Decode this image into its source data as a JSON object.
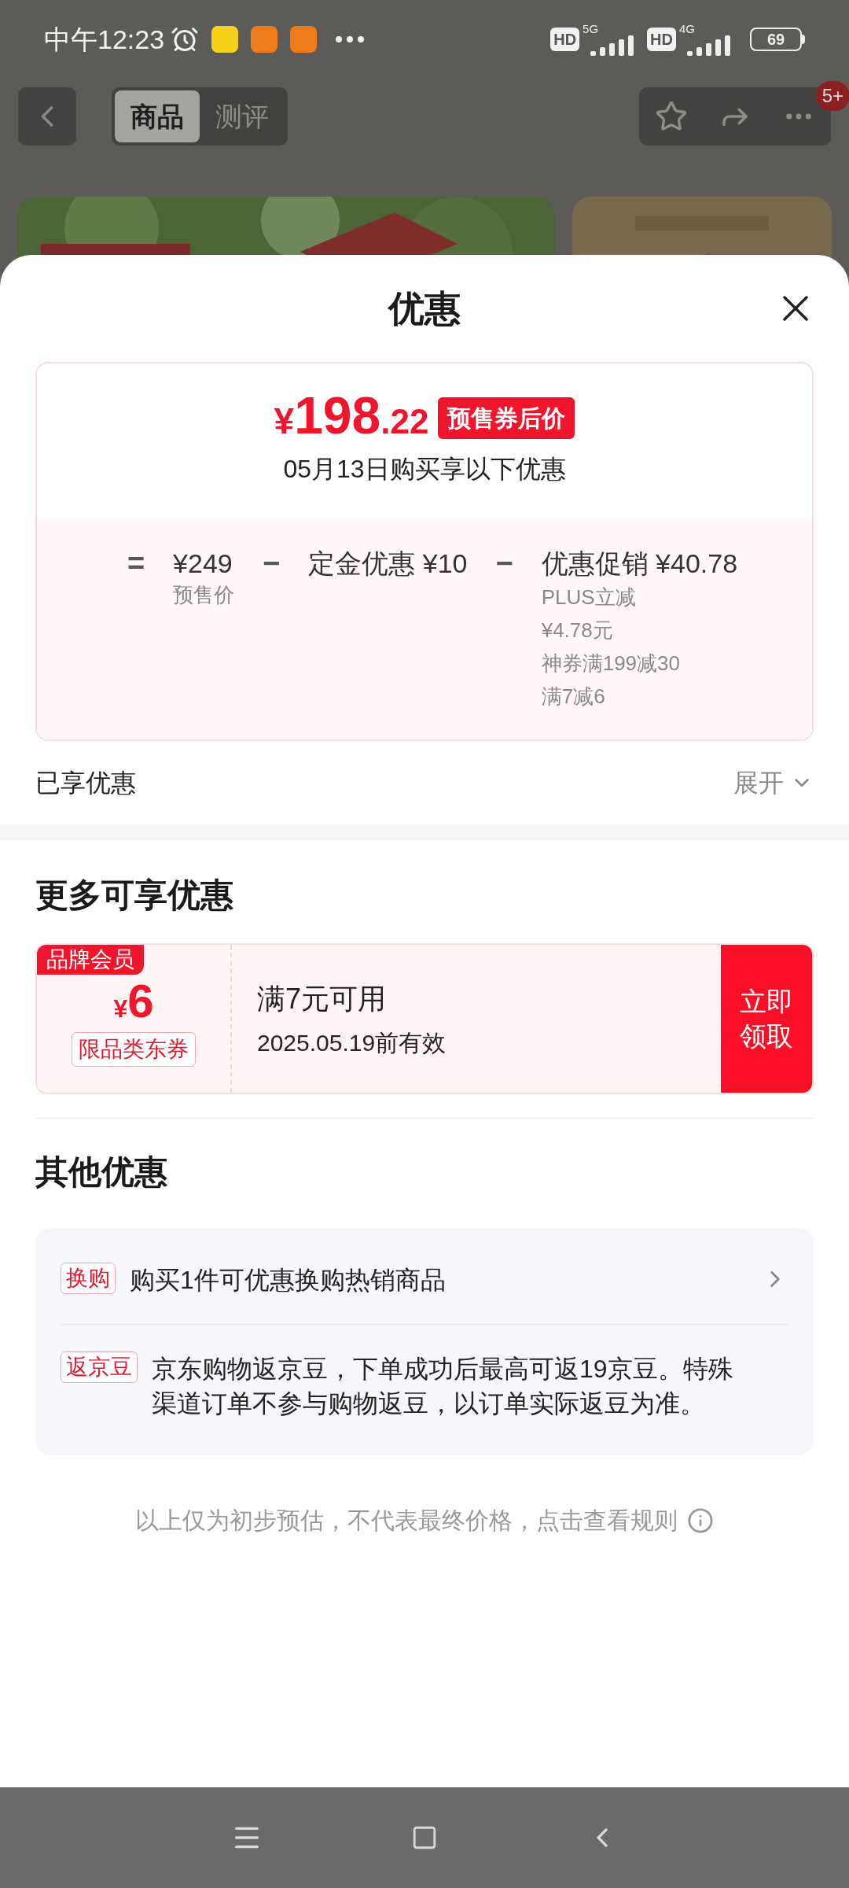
{
  "status_bar": {
    "time": "中午12:23",
    "network_1": {
      "label": "HD",
      "type": "5G"
    },
    "network_2": {
      "label": "HD",
      "type": "4G"
    },
    "battery": "69"
  },
  "header": {
    "tabs": [
      {
        "label": "商品",
        "selected": true
      },
      {
        "label": "测评",
        "selected": false
      }
    ],
    "badge": "5+"
  },
  "sheet": {
    "title": "优惠",
    "price": {
      "symbol": "¥",
      "integer": "198",
      "decimal": ".22",
      "tag": "预售券后价",
      "note": "05月13日购买享以下优惠"
    },
    "breakdown": [
      {
        "op": "=",
        "amount": "¥249",
        "caption": "预售价"
      },
      {
        "op": "−",
        "amount": "定金优惠 ¥10"
      },
      {
        "op": "−",
        "amount": "优惠促销 ¥40.78",
        "details": [
          "PLUS立减",
          "¥4.78元",
          "神券满199减30",
          "满7减6"
        ]
      }
    ],
    "enjoyed": {
      "label": "已享优惠",
      "toggle": "展开",
      "expanded": false
    },
    "more_title": "更多可享优惠",
    "coupon": {
      "tag": "品牌会员",
      "symbol": "¥",
      "amount": "6",
      "scope": "限品类东券",
      "condition": "满7元可用",
      "validity": "2025.05.19前有效",
      "button": "立即领取"
    },
    "other_title": "其他优惠",
    "others": [
      {
        "tag": "换购",
        "text": "购买1件可优惠换购热销商品",
        "link": true
      },
      {
        "tag": "返京豆",
        "text": "京东购物返京豆，下单成功后最高可返19京豆。特殊渠道订单不参与购物返豆，以订单实际返豆为准。",
        "link": false
      }
    ],
    "footnote": "以上仅为初步预估，不代表最终价格，点击查看规则"
  }
}
